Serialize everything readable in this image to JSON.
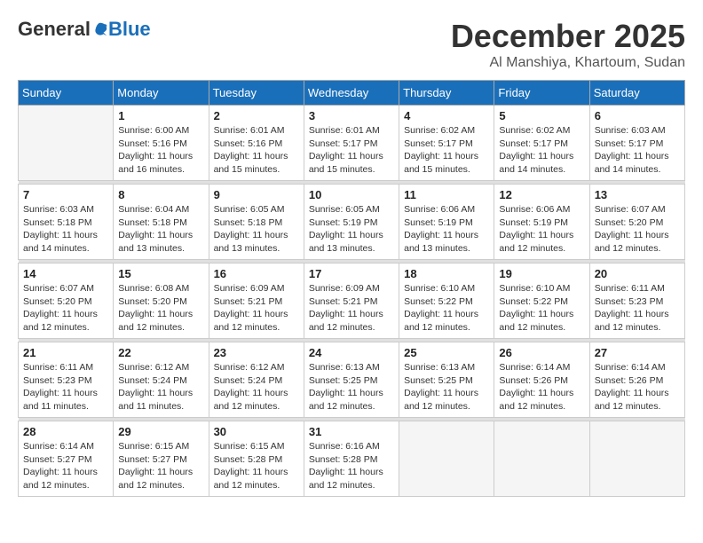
{
  "header": {
    "logo_general": "General",
    "logo_blue": "Blue",
    "month": "December 2025",
    "location": "Al Manshiya, Khartoum, Sudan"
  },
  "weekdays": [
    "Sunday",
    "Monday",
    "Tuesday",
    "Wednesday",
    "Thursday",
    "Friday",
    "Saturday"
  ],
  "weeks": [
    [
      {
        "day": "",
        "empty": true
      },
      {
        "day": "1",
        "sunrise": "6:00 AM",
        "sunset": "5:16 PM",
        "daylight": "11 hours and 16 minutes."
      },
      {
        "day": "2",
        "sunrise": "6:01 AM",
        "sunset": "5:16 PM",
        "daylight": "11 hours and 15 minutes."
      },
      {
        "day": "3",
        "sunrise": "6:01 AM",
        "sunset": "5:17 PM",
        "daylight": "11 hours and 15 minutes."
      },
      {
        "day": "4",
        "sunrise": "6:02 AM",
        "sunset": "5:17 PM",
        "daylight": "11 hours and 15 minutes."
      },
      {
        "day": "5",
        "sunrise": "6:02 AM",
        "sunset": "5:17 PM",
        "daylight": "11 hours and 14 minutes."
      },
      {
        "day": "6",
        "sunrise": "6:03 AM",
        "sunset": "5:17 PM",
        "daylight": "11 hours and 14 minutes."
      }
    ],
    [
      {
        "day": "7",
        "sunrise": "6:03 AM",
        "sunset": "5:18 PM",
        "daylight": "11 hours and 14 minutes."
      },
      {
        "day": "8",
        "sunrise": "6:04 AM",
        "sunset": "5:18 PM",
        "daylight": "11 hours and 13 minutes."
      },
      {
        "day": "9",
        "sunrise": "6:05 AM",
        "sunset": "5:18 PM",
        "daylight": "11 hours and 13 minutes."
      },
      {
        "day": "10",
        "sunrise": "6:05 AM",
        "sunset": "5:19 PM",
        "daylight": "11 hours and 13 minutes."
      },
      {
        "day": "11",
        "sunrise": "6:06 AM",
        "sunset": "5:19 PM",
        "daylight": "11 hours and 13 minutes."
      },
      {
        "day": "12",
        "sunrise": "6:06 AM",
        "sunset": "5:19 PM",
        "daylight": "11 hours and 12 minutes."
      },
      {
        "day": "13",
        "sunrise": "6:07 AM",
        "sunset": "5:20 PM",
        "daylight": "11 hours and 12 minutes."
      }
    ],
    [
      {
        "day": "14",
        "sunrise": "6:07 AM",
        "sunset": "5:20 PM",
        "daylight": "11 hours and 12 minutes."
      },
      {
        "day": "15",
        "sunrise": "6:08 AM",
        "sunset": "5:20 PM",
        "daylight": "11 hours and 12 minutes."
      },
      {
        "day": "16",
        "sunrise": "6:09 AM",
        "sunset": "5:21 PM",
        "daylight": "11 hours and 12 minutes."
      },
      {
        "day": "17",
        "sunrise": "6:09 AM",
        "sunset": "5:21 PM",
        "daylight": "11 hours and 12 minutes."
      },
      {
        "day": "18",
        "sunrise": "6:10 AM",
        "sunset": "5:22 PM",
        "daylight": "11 hours and 12 minutes."
      },
      {
        "day": "19",
        "sunrise": "6:10 AM",
        "sunset": "5:22 PM",
        "daylight": "11 hours and 12 minutes."
      },
      {
        "day": "20",
        "sunrise": "6:11 AM",
        "sunset": "5:23 PM",
        "daylight": "11 hours and 12 minutes."
      }
    ],
    [
      {
        "day": "21",
        "sunrise": "6:11 AM",
        "sunset": "5:23 PM",
        "daylight": "11 hours and 11 minutes."
      },
      {
        "day": "22",
        "sunrise": "6:12 AM",
        "sunset": "5:24 PM",
        "daylight": "11 hours and 11 minutes."
      },
      {
        "day": "23",
        "sunrise": "6:12 AM",
        "sunset": "5:24 PM",
        "daylight": "11 hours and 12 minutes."
      },
      {
        "day": "24",
        "sunrise": "6:13 AM",
        "sunset": "5:25 PM",
        "daylight": "11 hours and 12 minutes."
      },
      {
        "day": "25",
        "sunrise": "6:13 AM",
        "sunset": "5:25 PM",
        "daylight": "11 hours and 12 minutes."
      },
      {
        "day": "26",
        "sunrise": "6:14 AM",
        "sunset": "5:26 PM",
        "daylight": "11 hours and 12 minutes."
      },
      {
        "day": "27",
        "sunrise": "6:14 AM",
        "sunset": "5:26 PM",
        "daylight": "11 hours and 12 minutes."
      }
    ],
    [
      {
        "day": "28",
        "sunrise": "6:14 AM",
        "sunset": "5:27 PM",
        "daylight": "11 hours and 12 minutes."
      },
      {
        "day": "29",
        "sunrise": "6:15 AM",
        "sunset": "5:27 PM",
        "daylight": "11 hours and 12 minutes."
      },
      {
        "day": "30",
        "sunrise": "6:15 AM",
        "sunset": "5:28 PM",
        "daylight": "11 hours and 12 minutes."
      },
      {
        "day": "31",
        "sunrise": "6:16 AM",
        "sunset": "5:28 PM",
        "daylight": "11 hours and 12 minutes."
      },
      {
        "day": "",
        "empty": true
      },
      {
        "day": "",
        "empty": true
      },
      {
        "day": "",
        "empty": true
      }
    ]
  ]
}
